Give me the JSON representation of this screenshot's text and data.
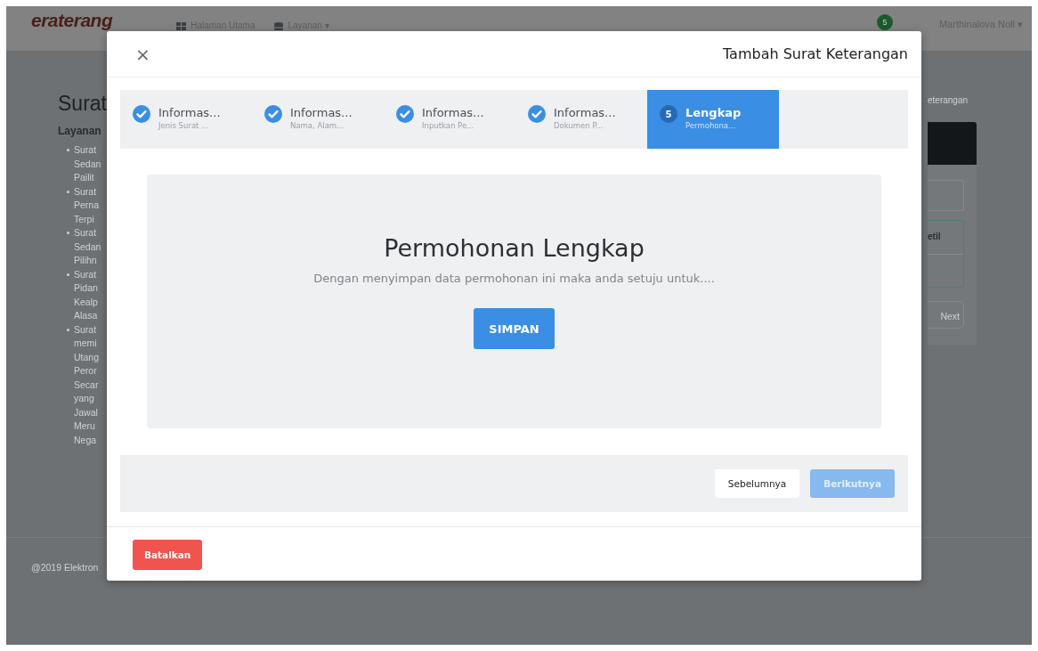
{
  "background_page": {
    "navbar": {
      "logo": "eraterang",
      "links": [
        {
          "label": "Halaman Utama"
        },
        {
          "label": "Layanan ▾"
        }
      ],
      "notification_badge": "5",
      "user_menu": "Marthinalova Noll ▾"
    },
    "page_title": "Surat",
    "sidebar": {
      "heading": "Layanan",
      "items": [
        {
          "lines": [
            "Surat",
            "Sedan",
            "Pailit"
          ]
        },
        {
          "lines": [
            "Surat",
            "Perna",
            "Terpi"
          ]
        },
        {
          "lines": [
            "Surat",
            "Sedan",
            "Pilihn"
          ]
        },
        {
          "lines": [
            "Surat",
            "Pidan",
            "Kealp",
            "Alasa"
          ]
        },
        {
          "lines": [
            "Surat",
            "memi",
            "Utang",
            "Peror",
            "Secar",
            "yang",
            "Jawal",
            "Meru",
            "Nega"
          ]
        }
      ]
    },
    "breadcrumb": "eterangan",
    "panel": {
      "row_label": "etil",
      "button": "Next"
    },
    "footer": "@2019 Elektron"
  },
  "modal": {
    "close": "×",
    "title": "Tambah Surat Keterangan",
    "steps": [
      {
        "title": "Informas...",
        "subtitle": "Jenis Surat ...",
        "completed": true,
        "selected": false
      },
      {
        "title": "Informas...",
        "subtitle": "Nama, Alam...",
        "completed": true,
        "selected": false
      },
      {
        "title": "Informas...",
        "subtitle": "Inputkan Pe...",
        "completed": true,
        "selected": false
      },
      {
        "title": "Informas...",
        "subtitle": "Dokumen P...",
        "completed": true,
        "selected": false
      },
      {
        "title": "Lengkap",
        "subtitle": "Permohona...",
        "completed": false,
        "selected": true,
        "number": "5"
      }
    ],
    "content": {
      "heading": "Permohonan Lengkap",
      "message": "Dengan menyimpan data permohonan ini maka anda setuju untuk....",
      "save_button": "SIMPAN"
    },
    "nav_buttons": [
      {
        "label": "Sebelumnya",
        "disabled": false
      },
      {
        "label": "Berikutnya",
        "disabled": true
      }
    ],
    "cancel_button": "Batalkan"
  }
}
